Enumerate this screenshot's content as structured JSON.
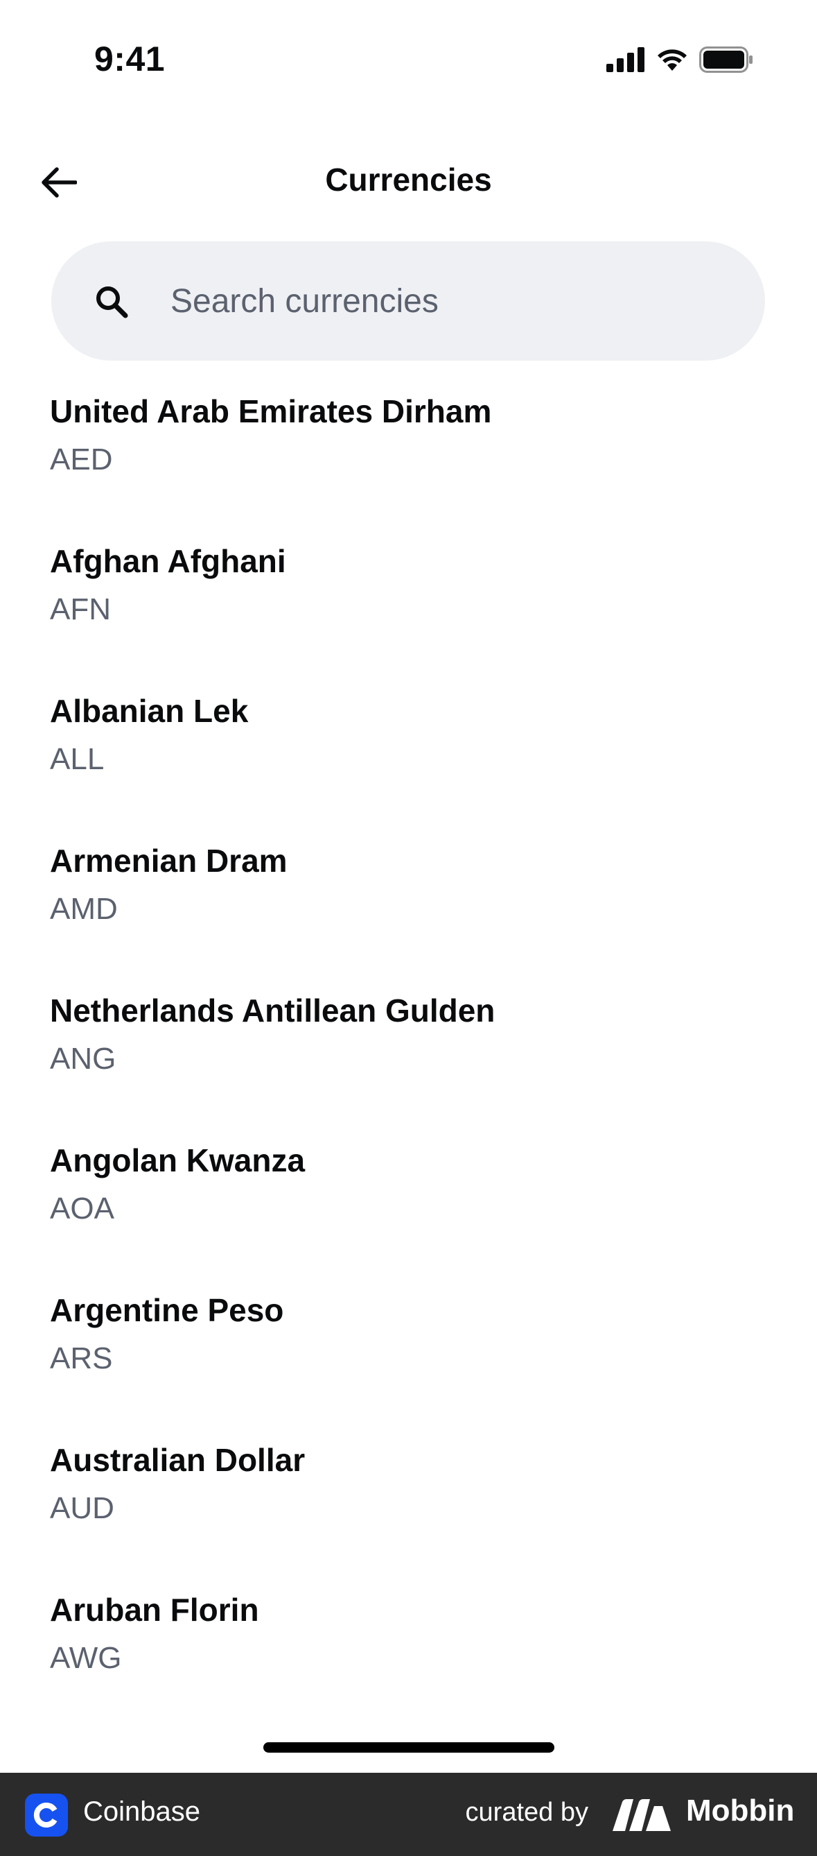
{
  "status_bar": {
    "time": "9:41"
  },
  "header": {
    "title": "Currencies",
    "back_icon": "arrow-left-icon"
  },
  "search": {
    "placeholder": "Search currencies",
    "value": "",
    "icon": "search-icon"
  },
  "currencies": [
    {
      "name": "United Arab Emirates Dirham",
      "code": "AED"
    },
    {
      "name": "Afghan Afghani",
      "code": "AFN"
    },
    {
      "name": "Albanian Lek",
      "code": "ALL"
    },
    {
      "name": "Armenian Dram",
      "code": "AMD"
    },
    {
      "name": "Netherlands Antillean Gulden",
      "code": "ANG"
    },
    {
      "name": "Angolan Kwanza",
      "code": "AOA"
    },
    {
      "name": "Argentine Peso",
      "code": "ARS"
    },
    {
      "name": "Australian Dollar",
      "code": "AUD"
    },
    {
      "name": "Aruban Florin",
      "code": "AWG"
    }
  ],
  "footer": {
    "app_name": "Coinbase",
    "curated_by": "curated by",
    "brand": "Mobbin"
  },
  "colors": {
    "text_primary": "#0a0b0d",
    "text_secondary": "#5b616e",
    "search_background": "#eef0f3",
    "coinbase_blue": "#1652f0",
    "footer_background": "#2b2b2b"
  }
}
